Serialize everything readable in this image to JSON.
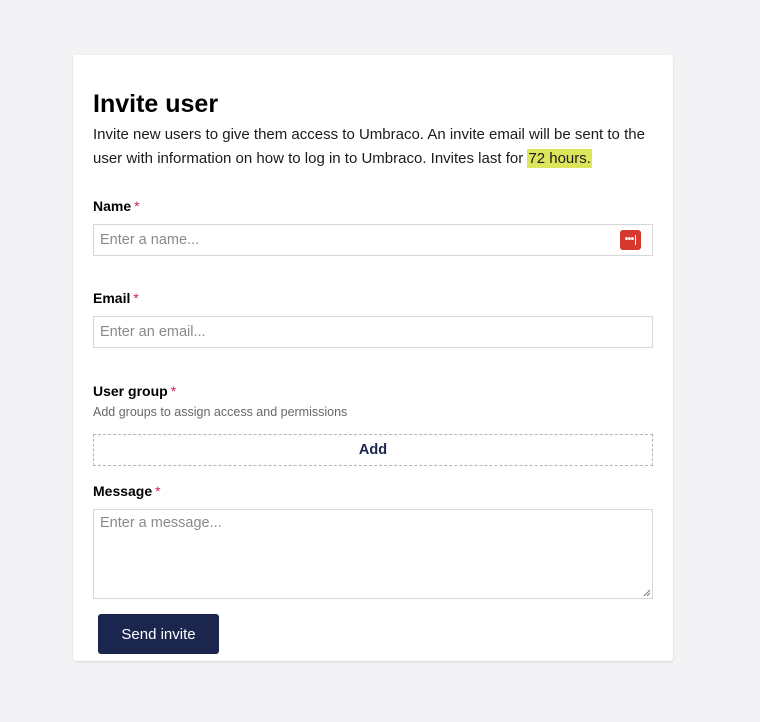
{
  "form": {
    "title": "Invite user",
    "intro_text": "Invite new users to give them access to Umbraco. An invite email will be sent to the user with information on how to log in to Umbraco. Invites last for ",
    "intro_highlight": "72 hours.",
    "required_marker": "*",
    "name": {
      "label": "Name",
      "placeholder": "Enter a name...",
      "value": ""
    },
    "email": {
      "label": "Email",
      "placeholder": "Enter an email...",
      "value": ""
    },
    "user_group": {
      "label": "User group",
      "description": "Add groups to assign access and permissions",
      "add_label": "Add"
    },
    "message": {
      "label": "Message",
      "placeholder": "Enter a message...",
      "value": ""
    },
    "send_label": "Send invite"
  },
  "icons": {
    "password_manager": "password-manager-icon",
    "resize": "resize-handle-icon"
  },
  "colors": {
    "primary": "#1b264f",
    "required": "#d42054",
    "highlight": "#dde55a",
    "password_manager": "#d6372f"
  }
}
